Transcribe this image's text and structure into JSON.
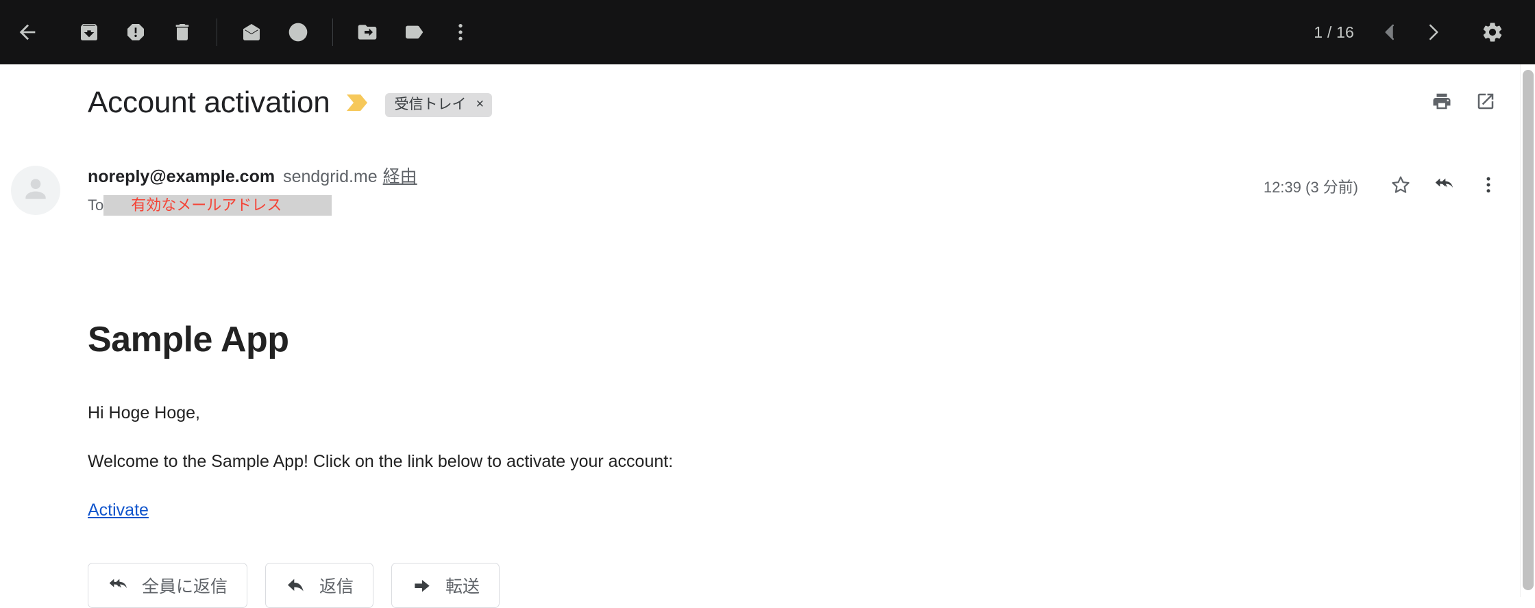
{
  "toolbar": {
    "back": "back-arrow",
    "actions": [
      {
        "name": "archive",
        "icon": "archive-icon"
      },
      {
        "name": "report-spam",
        "icon": "report-spam-icon"
      },
      {
        "name": "delete",
        "icon": "trash-icon"
      },
      {
        "name": "mark-unread",
        "icon": "envelope-icon"
      },
      {
        "name": "snooze",
        "icon": "clock-icon"
      },
      {
        "name": "move-to",
        "icon": "folder-move-icon"
      },
      {
        "name": "labels",
        "icon": "label-tag-icon"
      },
      {
        "name": "more",
        "icon": "more-vertical-icon"
      }
    ],
    "pager": "1 / 16",
    "prev_label": "chevron-left-icon",
    "next_label": "chevron-right-icon",
    "settings_label": "gear-icon"
  },
  "subject": {
    "title": "Account activation",
    "important_marker": "important-marker-icon",
    "label_chip": "受信トレイ",
    "label_chip_remove": "×",
    "print_label": "print-icon",
    "popout_label": "open-in-new-icon"
  },
  "message": {
    "sender_email": "noreply@example.com",
    "via_domain": "sendgrid.me",
    "via_word": "経由",
    "to_label": "To",
    "to_redacted": "有効なメールアドレス",
    "timestamp": "12:39 (3 分前)",
    "star_label": "star-outline-icon",
    "reply_all_label": "reply-all-icon",
    "more_label": "more-vertical-icon"
  },
  "body": {
    "heading": "Sample App",
    "greeting": "Hi Hoge Hoge,",
    "welcome": "Welcome to the Sample App! Click on the link below to activate your account:",
    "link": "Activate"
  },
  "actions": [
    {
      "label": "全員に返信",
      "icon": "reply-all-icon"
    },
    {
      "label": "返信",
      "icon": "reply-icon"
    },
    {
      "label": "転送",
      "icon": "forward-icon"
    }
  ],
  "colors": {
    "toolbar_bg": "#131314",
    "toolbar_icon": "#c4c7c5",
    "important_yellow": "#f6c85a",
    "link_blue": "#1155cc",
    "redaction_bg": "#d2d2d2",
    "redaction_text": "#f44336",
    "chip_bg": "#ddddde"
  }
}
